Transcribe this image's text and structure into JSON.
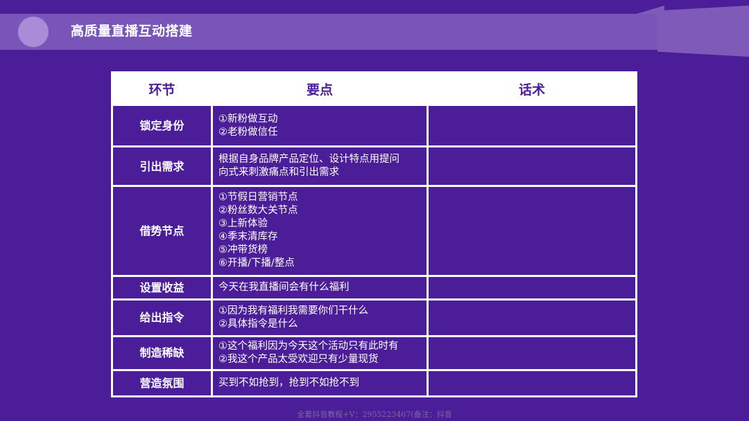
{
  "header": {
    "title": "高质量直播互动搭建"
  },
  "table": {
    "headers": [
      "环节",
      "要点",
      "话术"
    ],
    "rows": [
      {
        "stage": "锁定身份",
        "points": [
          "①新粉做互动",
          "②老粉做信任"
        ],
        "script": ""
      },
      {
        "stage": "引出需求",
        "points": [
          "根据自身品牌产品定位、设计特点用提问",
          "向式来刺激痛点和引出需求"
        ],
        "script": ""
      },
      {
        "stage": "借势节点",
        "points": [
          "①节假日营销节点",
          "②粉丝数大关节点",
          "③上新体验",
          "④季末清库存",
          "⑤冲带货榜",
          "⑥开播/下播/整点"
        ],
        "script": ""
      },
      {
        "stage": "设置收益",
        "points": [
          "今天在我直播间会有什么福利"
        ],
        "script": ""
      },
      {
        "stage": "给出指令",
        "points": [
          "①因为我有福利我需要你们干什么",
          "②具体指令是什么"
        ],
        "script": ""
      },
      {
        "stage": "制造稀缺",
        "points": [
          "①这个福利因为今天这个活动只有此时有",
          "②我这个产品太受欢迎只有少量现货"
        ],
        "script": ""
      },
      {
        "stage": "营造氛围",
        "points": [
          "买到不如抢到，抢到不如抢不到"
        ],
        "script": ""
      }
    ]
  },
  "footer": {
    "text": "全套抖音教程+V：2955223467(备注：抖音"
  },
  "colors": {
    "background": "#4b1d99",
    "band": "#7a55b9",
    "accent_circle": "#a98bd8",
    "table_bg": "#ffffff"
  }
}
